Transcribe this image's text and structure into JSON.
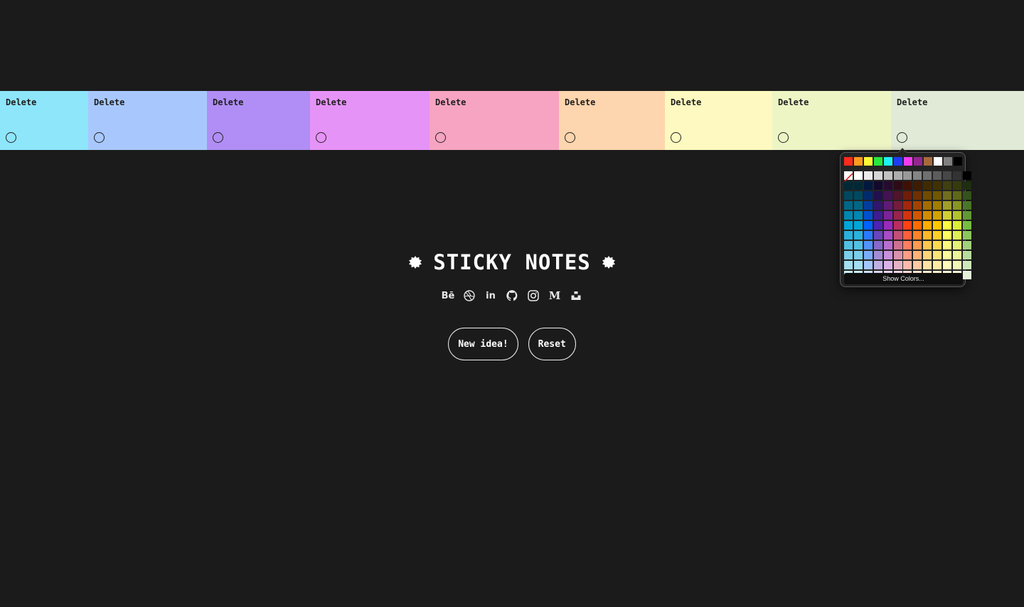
{
  "app": {
    "title": "STICKY NOTES"
  },
  "notes": [
    {
      "delete_label": "Delete",
      "color": "#8ee6fb"
    },
    {
      "delete_label": "Delete",
      "color": "#a8c8fd"
    },
    {
      "delete_label": "Delete",
      "color": "#b08ef5"
    },
    {
      "delete_label": "Delete",
      "color": "#e693f7"
    },
    {
      "delete_label": "Delete",
      "color": "#f6a4c1"
    },
    {
      "delete_label": "Delete",
      "color": "#fdd5ae"
    },
    {
      "delete_label": "Delete",
      "color": "#fdf9c0"
    },
    {
      "delete_label": "Delete",
      "color": "#eef5c5"
    },
    {
      "delete_label": "Delete",
      "color": "#e0ead6"
    }
  ],
  "social": [
    {
      "name": "behance-icon",
      "glyph": "Bē"
    },
    {
      "name": "dribbble-icon",
      "glyph": ""
    },
    {
      "name": "linkedin-icon",
      "glyph": "in"
    },
    {
      "name": "github-icon",
      "glyph": ""
    },
    {
      "name": "instagram-icon",
      "glyph": ""
    },
    {
      "name": "medium-icon",
      "glyph": "M"
    },
    {
      "name": "unsplash-icon",
      "glyph": ""
    }
  ],
  "actions": {
    "new_idea": "New idea!",
    "reset": "Reset"
  },
  "picker": {
    "show_colors_label": "Show Colors...",
    "top_row": [
      "#ff2b1c",
      "#ff9a1f",
      "#fdf935",
      "#27e83c",
      "#1ef2f5",
      "#1f3cf5",
      "#f23cf0",
      "#93278f",
      "#a86a3c",
      "#ffffff",
      "#808080",
      "#000000"
    ],
    "gray_row": [
      "none",
      "#ffffff",
      "#ebebeb",
      "#d6d6d6",
      "#c2c2c2",
      "#adadad",
      "#999999",
      "#858585",
      "#707070",
      "#5c5c5c",
      "#474747",
      "#333333",
      "#000000"
    ],
    "hue_columns": [
      "#00a3d7",
      "#0061fe",
      "#4d22b2",
      "#982abc",
      "#b92d5d",
      "#ff4015",
      "#ff6a00",
      "#ffab01",
      "#fcc700",
      "#fefb41",
      "#d9ec37",
      "#76bb40"
    ]
  }
}
